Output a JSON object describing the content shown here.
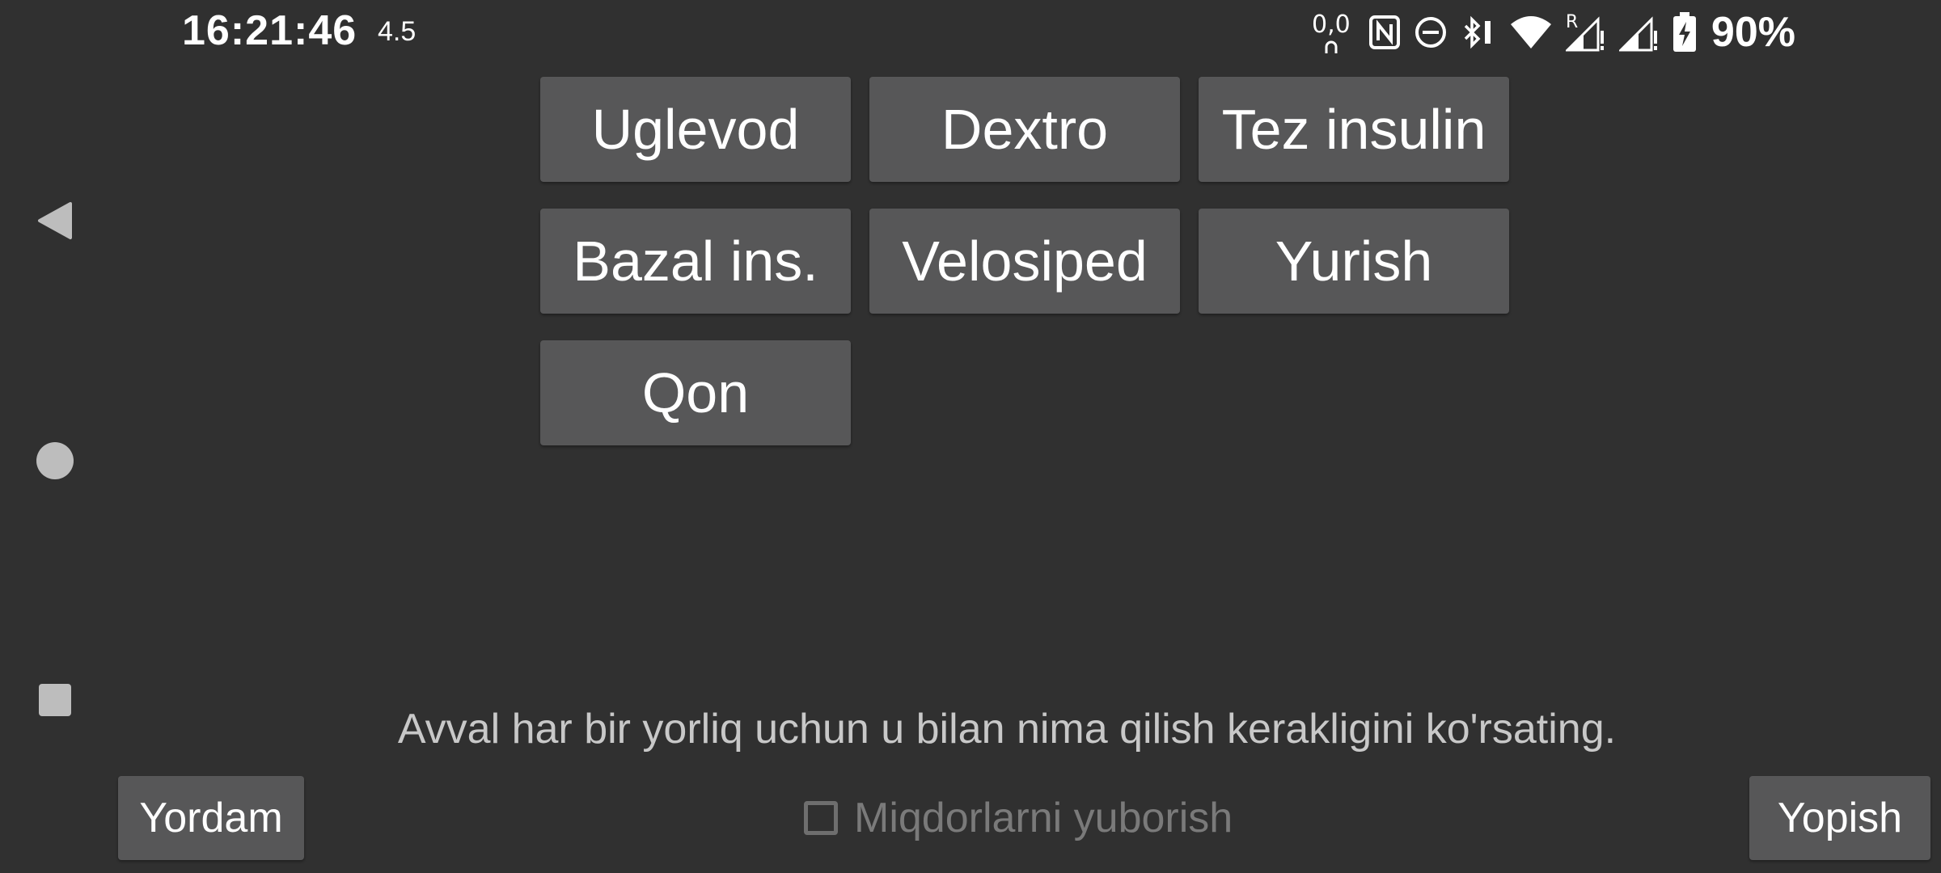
{
  "status_bar": {
    "time": "16:21:46",
    "net_speed": "4.5",
    "nfc_icon": "nfc-icon",
    "battery_percent": "90%",
    "icons": [
      "vr-glasses-icon",
      "nfc-icon",
      "do-not-disturb-icon",
      "bluetooth-icon",
      "wifi-icon",
      "signal-roaming-icon",
      "signal-icon",
      "battery-charging-icon"
    ],
    "roaming_label": "R"
  },
  "nav": {
    "back": "back-icon",
    "home": "home-icon",
    "recents": "recents-icon"
  },
  "tags": [
    {
      "label": "Uglevod"
    },
    {
      "label": "Dextro"
    },
    {
      "label": "Tez insulin"
    },
    {
      "label": "Bazal ins."
    },
    {
      "label": "Velosiped"
    },
    {
      "label": "Yurish"
    },
    {
      "label": "Qon"
    }
  ],
  "instruction": "Avval har bir yorliq uchun u bilan nima qilish kerakligini ko'rsating.",
  "help_button": "Yordam",
  "close_button": "Yopish",
  "send_amounts": {
    "label": "Miqdorlarni yuborish",
    "checked": false
  },
  "colors": {
    "background": "#303030",
    "button": "#575758",
    "text": "#ffffff",
    "disabled_text": "#7a7a7a"
  }
}
